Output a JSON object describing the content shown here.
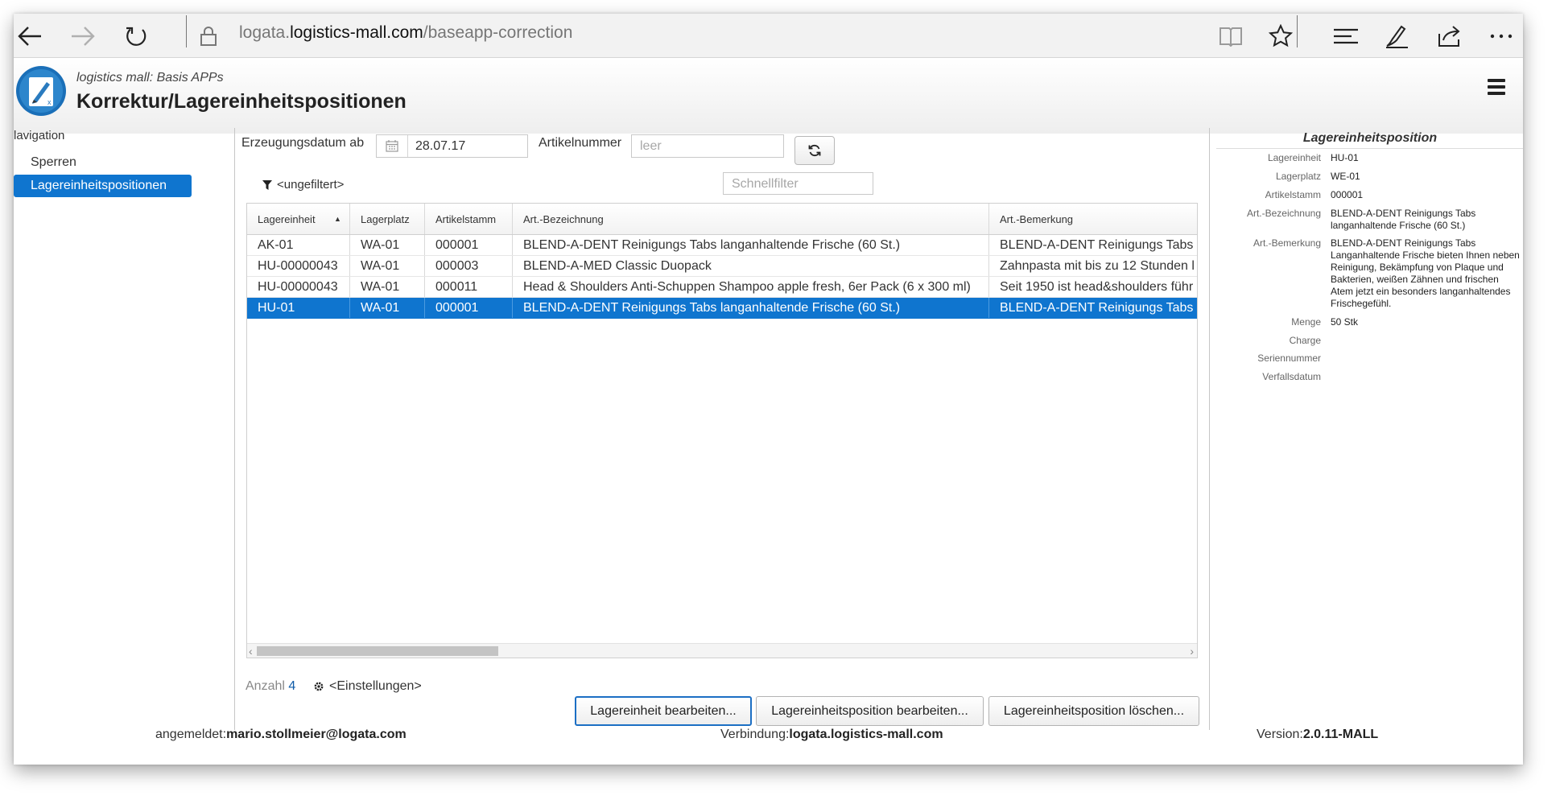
{
  "browser": {
    "url_prefix": "logata.",
    "url_host": "logistics-mall.com",
    "url_path": "/baseapp-correction"
  },
  "app": {
    "subtitle": "logistics mall: Basis APPs",
    "title": "Korrektur/Lagereinheitspositionen"
  },
  "navigation": {
    "label": "lavigation",
    "items": [
      {
        "label": "Sperren"
      },
      {
        "label": "Lagereinheitspositionen"
      }
    ]
  },
  "filters": {
    "date_label": "Erzeugungsdatum ab",
    "date_value": "28.07.17",
    "article_label": "Artikelnummer",
    "article_placeholder": "leer",
    "quickfilter_placeholder": "Schnellfilter",
    "filter_state": "<ungefiltert>"
  },
  "table": {
    "columns": [
      "Lagereinheit",
      "Lagerplatz",
      "Artikelstamm",
      "Art.-Bezeichnung",
      "Art.-Bemerkung"
    ],
    "rows": [
      [
        "AK-01",
        "WA-01",
        "000001",
        "BLEND-A-DENT Reinigungs Tabs langanhaltende Frische (60 St.)",
        "BLEND-A-DENT Reinigungs Tabs"
      ],
      [
        "HU-00000043",
        "WA-01",
        "000003",
        "BLEND-A-MED Classic Duopack",
        "Zahnpasta mit bis zu 12 Stunden l"
      ],
      [
        "HU-00000043",
        "WA-01",
        "000011",
        "Head & Shoulders Anti-Schuppen Shampoo apple fresh, 6er Pack (6 x 300 ml)",
        "Seit 1950 ist head&shoulders führ"
      ],
      [
        "HU-01",
        "WA-01",
        "000001",
        "BLEND-A-DENT Reinigungs Tabs langanhaltende Frische (60 St.)",
        "BLEND-A-DENT Reinigungs Tabs"
      ]
    ],
    "selected_row": 4,
    "count_label": "Anzahl",
    "count_value": "4",
    "settings_label": "<Einstellungen>"
  },
  "actions": {
    "edit_unit": "Lagereinheit bearbeiten...",
    "edit_position": "Lagereinheitsposition bearbeiten...",
    "delete_position": "Lagereinheitsposition löschen..."
  },
  "details": {
    "title": "Lagereinheitsposition",
    "fields": [
      {
        "label": "Lagereinheit",
        "value": "HU-01"
      },
      {
        "label": "Lagerplatz",
        "value": "WE-01"
      },
      {
        "label": "Artikelstamm",
        "value": "000001"
      },
      {
        "label": "Art.-Bezeichnung",
        "value": "BLEND-A-DENT Reinigungs Tabs langanhaltende Frische (60 St.)"
      },
      {
        "label": "Art.-Bemerkung",
        "value": "BLEND-A-DENT Reinigungs Tabs Langanhaltende Frische bieten Ihnen neben Reinigung, Bekämpfung von Plaque und Bakterien, weißen Zähnen und frischen Atem jetzt ein besonders langanhaltendes Frischegefühl."
      },
      {
        "label": "Menge",
        "value": "50 Stk"
      },
      {
        "label": "Charge",
        "value": ""
      },
      {
        "label": "Seriennummer",
        "value": ""
      },
      {
        "label": "Verfallsdatum",
        "value": ""
      }
    ]
  },
  "footer": {
    "user_label": "angemeldet:",
    "user_value": "mario.stollmeier@logata.com",
    "connection_label": "Verbindung:",
    "connection_value": "logata.logistics-mall.com",
    "version_label": "Version:",
    "version_value": "2.0.11-MALL"
  },
  "colors": {
    "accent": "#0f75cf"
  }
}
